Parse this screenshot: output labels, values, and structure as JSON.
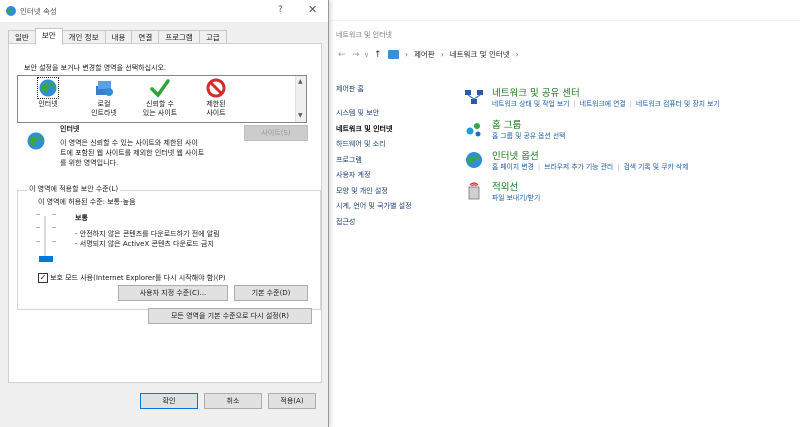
{
  "control_panel": {
    "title": "네트워크 및 인터넷",
    "breadcrumb": [
      "제어판",
      "네트워크 및 인터넷"
    ],
    "left_nav": {
      "home": "제어판 홈",
      "items": [
        "시스템 및 보안",
        "네트워크 및 인터넷",
        "하드웨어 및 소리",
        "프로그램",
        "사용자 계정",
        "모양 및 개인 설정",
        "시계, 언어 및 국가별 설정",
        "접근성"
      ]
    },
    "categories": [
      {
        "title": "네트워크 및 공유 센터",
        "icon": "network-sharing-icon",
        "links": [
          "네트워크 상태 및 작업 보기",
          "네트워크에 연결",
          "네트워크 컴퓨터 및 장치 보기"
        ]
      },
      {
        "title": "홈 그룹",
        "icon": "homegroup-icon",
        "links": [
          "홈 그룹 및 공유 옵션 선택"
        ]
      },
      {
        "title": "인터넷 옵션",
        "icon": "internet-options-icon",
        "links": [
          "홈 페이지 변경",
          "브라우저 추가 기능 관리",
          "검색 기록 및 쿠키 삭제"
        ]
      },
      {
        "title": "적외선",
        "icon": "infrared-icon",
        "links": [
          "파일 보내기/받기"
        ]
      }
    ]
  },
  "dialog": {
    "title": "인터넷 속성",
    "help": "?",
    "close": "✕",
    "tabs": [
      "일반",
      "보안",
      "개인 정보",
      "내용",
      "연결",
      "프로그램",
      "고급"
    ],
    "active_tab": "보안",
    "instruction": "보안 설정을 보거나 변경할 영역을 선택하십시오.",
    "zones": [
      {
        "label1": "인터넷",
        "label2": "",
        "icon": "globe-icon"
      },
      {
        "label1": "로컬",
        "label2": "인트라넷",
        "icon": "intranet-icon"
      },
      {
        "label1": "신뢰할 수",
        "label2": "있는 사이트",
        "icon": "checkmark-icon"
      },
      {
        "label1": "제한된",
        "label2": "사이트",
        "icon": "restricted-icon"
      }
    ],
    "zone_name": "인터넷",
    "zone_desc": [
      "이 영역은 신뢰할 수 있는 사이트와 제한된 사이",
      "트에 포함된 웹 사이트를 제외한 인터넷 웹 사이트",
      "를 위한 영역입니다."
    ],
    "sites_button": "사이트(S)",
    "group_label": "이 영역에 적용할 보안 수준(L)",
    "allowed_levels": "이 영역에 허용된 수준: 보통-높음",
    "level_name": "보통",
    "level_items": [
      "- 안전하지 않은 콘텐츠를 다운로드하기 전에 알림",
      "- 서명되지 않은 ActiveX 콘텐츠 다운로드 금지"
    ],
    "protected_mode": "보호 모드 사용(Internet Explorer를 다시 시작해야 함)(P)",
    "protected_mode_checked": "✓",
    "custom_level_button": "사용자 지정 수준(C)...",
    "default_level_button": "기본 수준(D)",
    "reset_all_button": "모든 영역을 기본 수준으로 다시 설정(R)",
    "ok_button": "확인",
    "cancel_button": "취소",
    "apply_button": "적용(A)"
  }
}
